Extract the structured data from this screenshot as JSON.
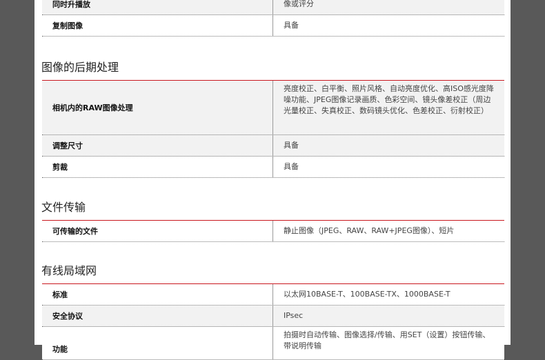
{
  "table_top": {
    "rows": [
      {
        "label": "同时升播放",
        "value": "像或评分"
      },
      {
        "label": "复制图像",
        "value": "具备"
      }
    ]
  },
  "section_postprocess": {
    "title": "图像的后期处理",
    "rows": [
      {
        "label": "相机内的RAW图像处理",
        "value": "亮度校正、白平衡、照片风格、自动亮度优化、高ISO感光度降噪功能、JPEG图像记录画质、色彩空间、镜头像差校正（周边光量校正、失真校正、数码镜头优化、色差校正、衍射校正）"
      },
      {
        "label": "调整尺寸",
        "value": "具备"
      },
      {
        "label": "剪裁",
        "value": "具备"
      }
    ]
  },
  "section_transfer": {
    "title": "文件传输",
    "rows": [
      {
        "label": "可传输的文件",
        "value": "静止图像（JPEG、RAW、RAW+JPEG图像）、短片"
      }
    ]
  },
  "section_lan": {
    "title": "有线局域网",
    "rows": [
      {
        "label": "标准",
        "value": "以太网10BASE-T、100BASE-TX、1000BASE-T"
      },
      {
        "label": "安全协议",
        "value": "IPsec"
      },
      {
        "label": "功能",
        "value": "拍摄时自动传输、图像选择/传输、用SET（设置）按钮传输、带说明传输"
      }
    ]
  }
}
